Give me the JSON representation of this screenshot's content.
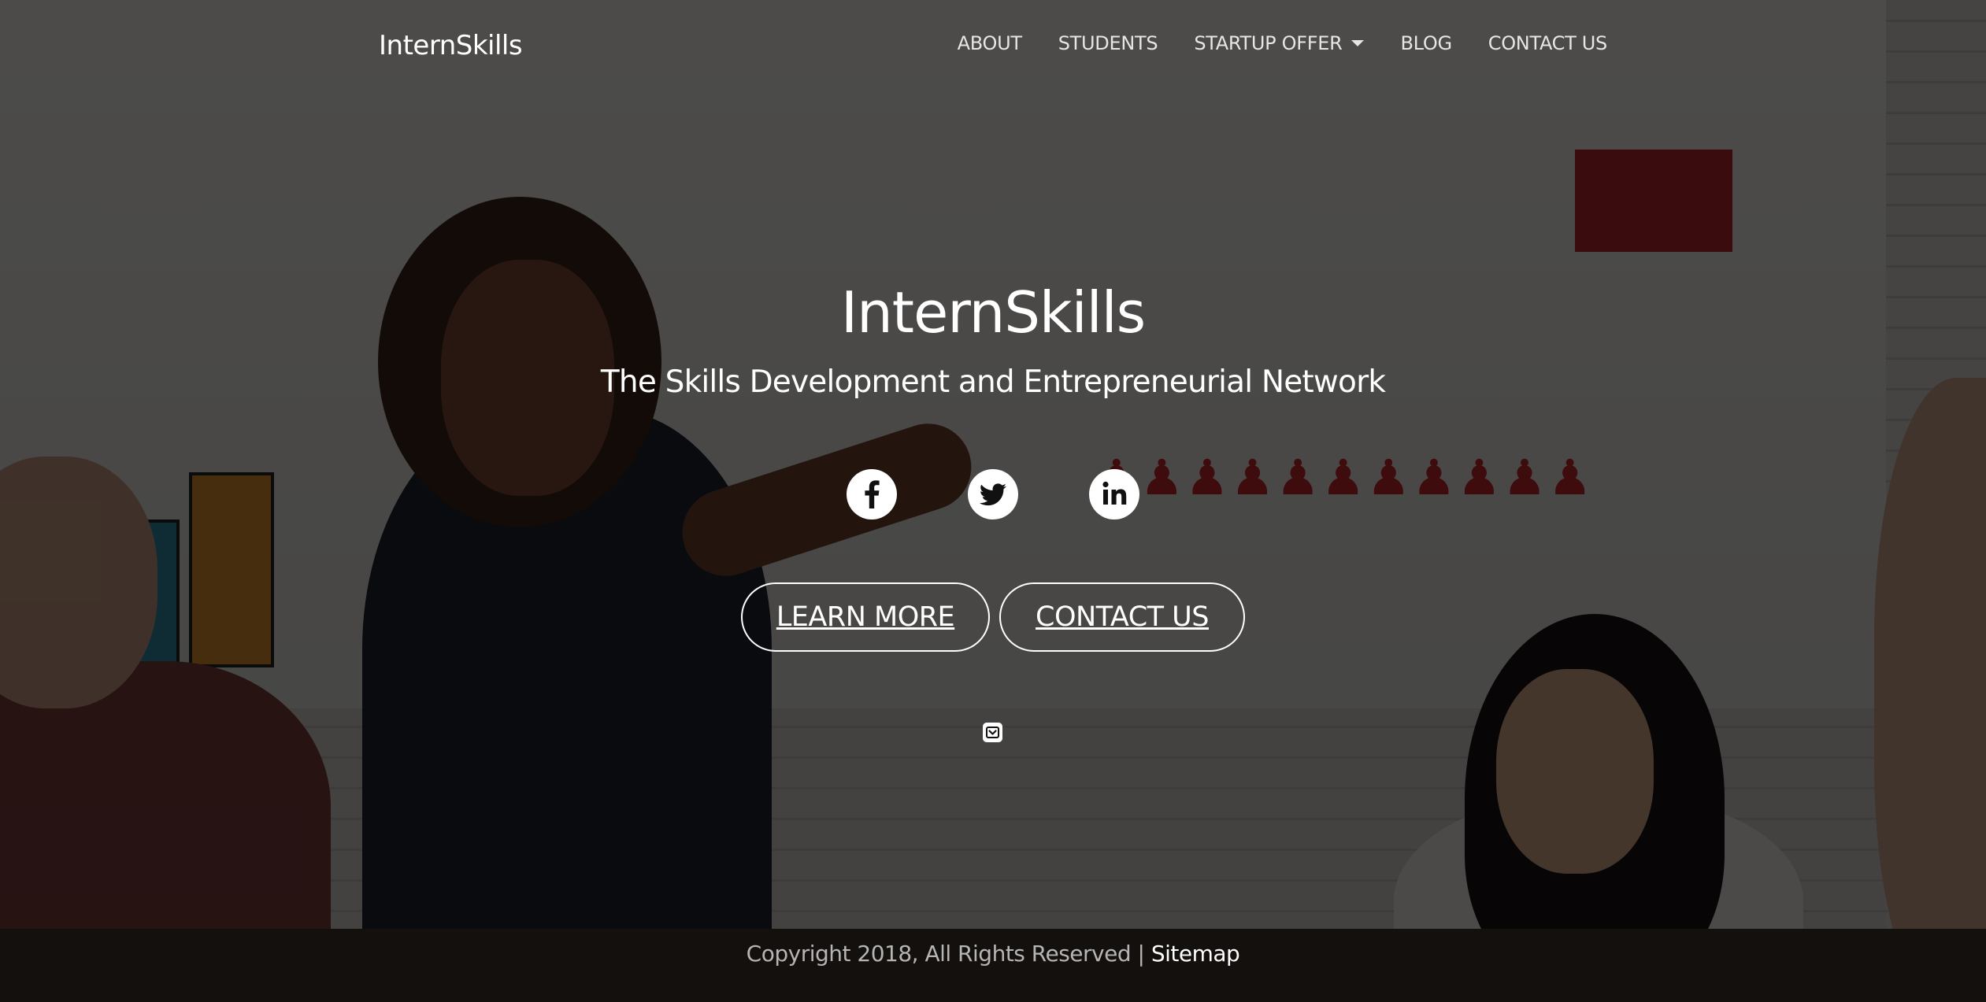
{
  "brand": "InternSkills",
  "nav": {
    "items": [
      {
        "label": "ABOUT"
      },
      {
        "label": "STUDENTS"
      },
      {
        "label": "STARTUP OFFER",
        "has_dropdown": true
      },
      {
        "label": "BLOG"
      },
      {
        "label": "CONTACT US"
      }
    ]
  },
  "hero": {
    "title": "InternSkills",
    "subtitle": "The Skills Development and Entrepreneurial Network",
    "social": [
      {
        "icon": "facebook-icon"
      },
      {
        "icon": "twitter-icon"
      },
      {
        "icon": "linkedin-icon"
      }
    ],
    "buttons": {
      "learn_more": "LEARN MORE",
      "contact_us": "CONTACT US"
    },
    "scroll_icon": "chevron-down-box-icon"
  },
  "footer": {
    "copyright": "Copyright 2018, All Rights Reserved | ",
    "sitemap_label": "Sitemap"
  },
  "colors": {
    "text": "#ffffff",
    "nav_text": "#e6e6e6",
    "footer_text": "#b5b5b5",
    "overlay": "rgba(0,0,0,0.68)"
  }
}
